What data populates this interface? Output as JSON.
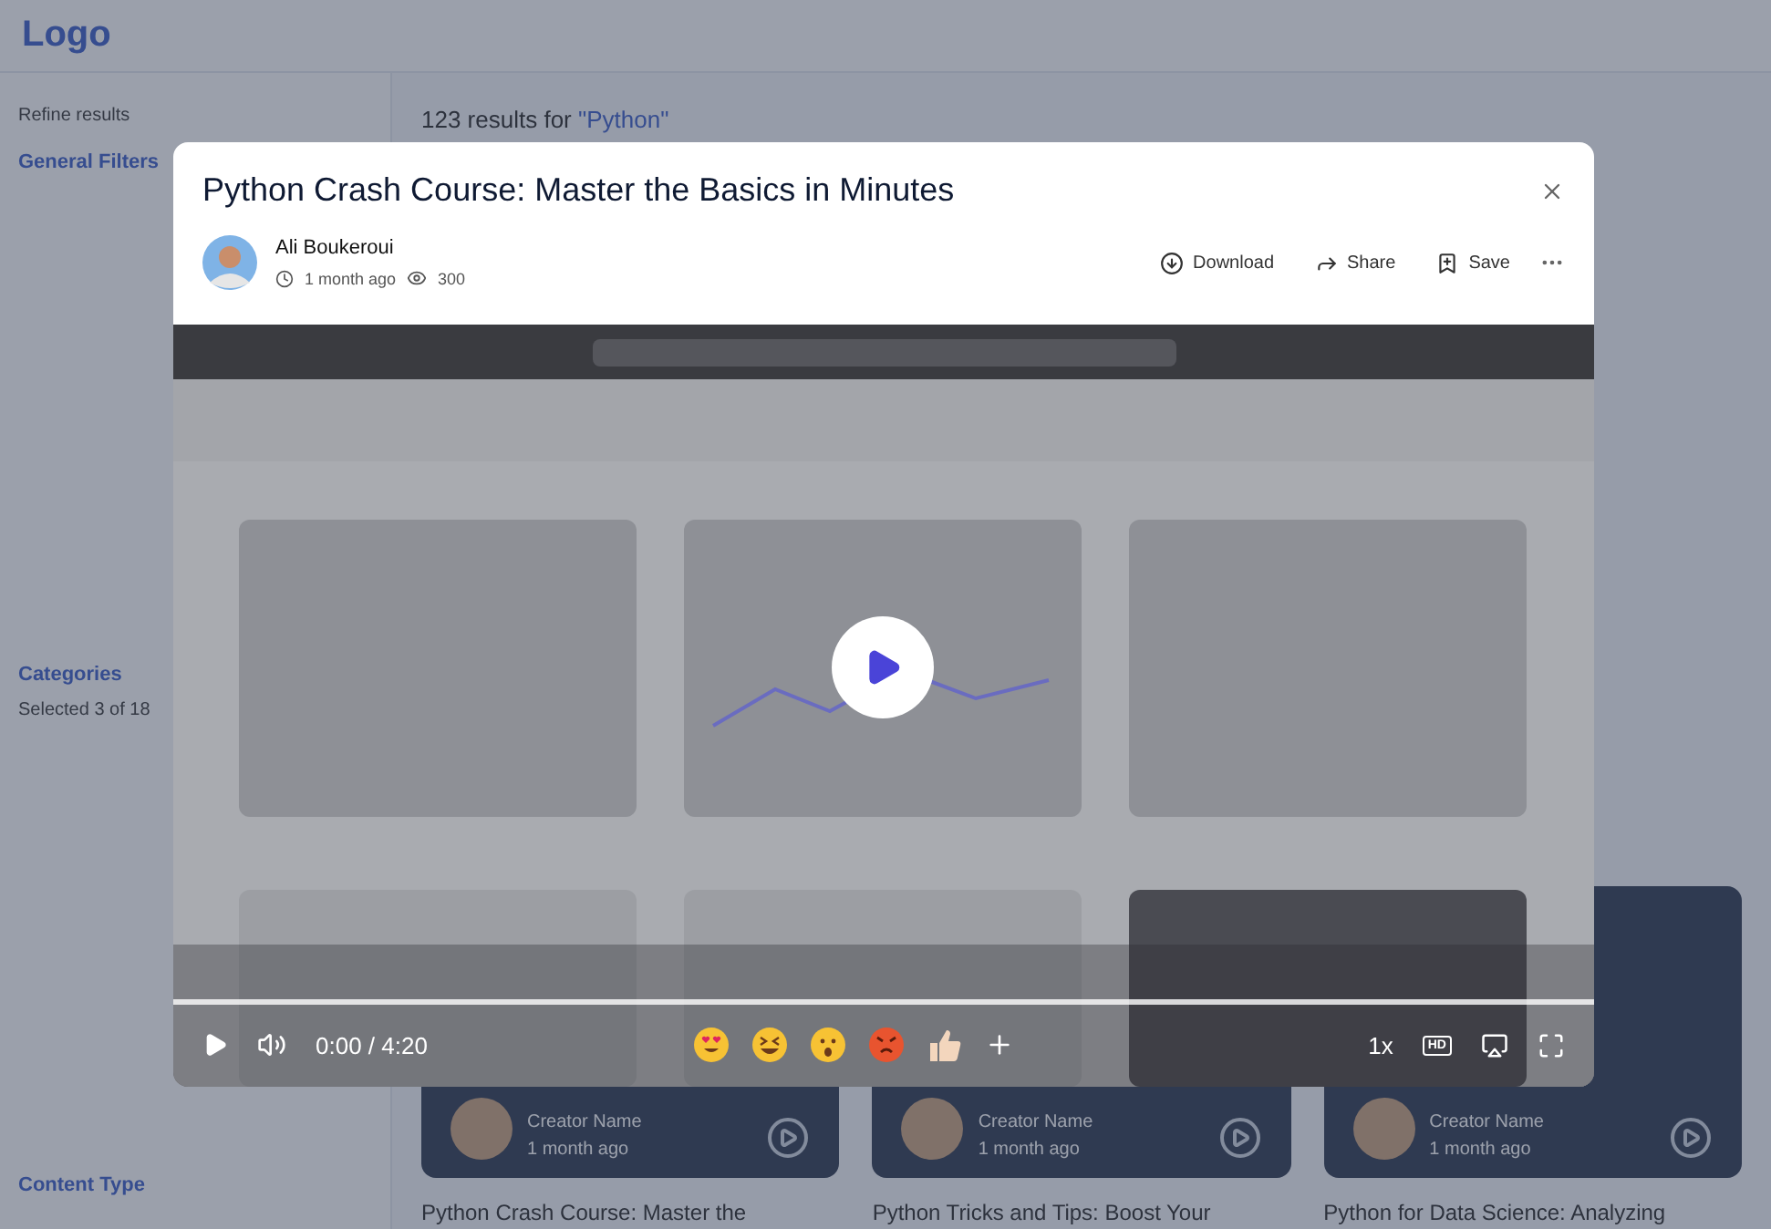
{
  "background": {
    "logo": "Logo",
    "refine_title": "Refine results",
    "results_heading": "123 results for ",
    "query": "\"Python\"",
    "sidebar_sections": [
      {
        "title": "General Filters"
      },
      {
        "title": "Categories",
        "note": "Selected 3 of 18"
      },
      {
        "title": "Content Type"
      }
    ],
    "cards": [
      {
        "creator": "Creator Name",
        "ago": "1 month ago",
        "title": "Python Crash Course: Master the"
      },
      {
        "creator": "Creator Name",
        "ago": "1 month ago",
        "title": "Python Tricks and Tips: Boost Your"
      },
      {
        "creator": "Creator Name",
        "ago": "1 month ago",
        "title": "Python for Data Science: Analyzing"
      }
    ]
  },
  "modal": {
    "title": "Python Crash Course: Master the Basics in Minutes",
    "author": "Ali Boukeroui",
    "posted": "1 month ago",
    "views": "300",
    "actions": [
      {
        "kind": "download",
        "label": "Download"
      },
      {
        "kind": "share",
        "label": "Share"
      },
      {
        "kind": "save",
        "label": "Save"
      }
    ]
  },
  "player": {
    "playing": false,
    "level": 0,
    "time": "0:00 / 4:20",
    "speed": "1x",
    "quality": "HD"
  }
}
